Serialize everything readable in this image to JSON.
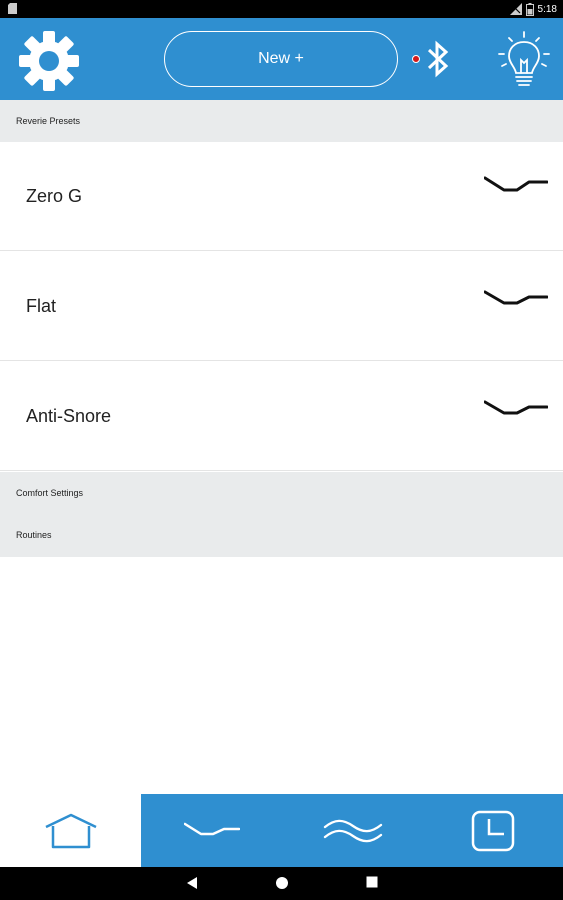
{
  "status_bar": {
    "time": "5:18"
  },
  "header": {
    "new_button_label": "New +"
  },
  "sections": {
    "presets": "Reverie Presets",
    "comfort": "Comfort Settings",
    "routines": "Routines"
  },
  "presets": [
    {
      "label": "Zero G"
    },
    {
      "label": "Flat"
    },
    {
      "label": "Anti-Snore"
    }
  ],
  "colors": {
    "brand_blue": "#2f8fd0",
    "section_gray": "#e9ebec",
    "bt_indicator": "#d41a1a"
  },
  "icons": {
    "header": [
      "gear-icon",
      "bluetooth-icon",
      "lightbulb-icon"
    ],
    "tabs": [
      "home-icon",
      "bed-position-icon",
      "massage-wave-icon",
      "clock-icon"
    ],
    "nav": [
      "back-icon",
      "home-nav-icon",
      "recents-icon"
    ]
  }
}
